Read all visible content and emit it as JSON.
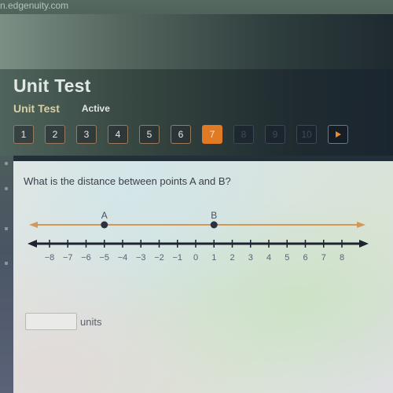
{
  "browser": {
    "url_fragment": "n.edgenuity.com"
  },
  "header": {
    "title": "Unit Test",
    "subtitle": "Unit Test",
    "status": "Active"
  },
  "question_nav": {
    "buttons": [
      {
        "label": "1",
        "state": "answered"
      },
      {
        "label": "2",
        "state": "answered"
      },
      {
        "label": "3",
        "state": "answered"
      },
      {
        "label": "4",
        "state": "answered"
      },
      {
        "label": "5",
        "state": "answered"
      },
      {
        "label": "6",
        "state": "answered"
      },
      {
        "label": "7",
        "state": "current"
      },
      {
        "label": "8",
        "state": "disabled"
      },
      {
        "label": "9",
        "state": "disabled"
      },
      {
        "label": "10",
        "state": "disabled"
      }
    ],
    "next_icon": "play-arrow-icon",
    "accent_color": "#e07a24"
  },
  "question": {
    "text": "What is the distance between points A and B?"
  },
  "number_line": {
    "min": -8,
    "max": 8,
    "tick_labels": [
      "−8",
      "−7",
      "−6",
      "−5",
      "−4",
      "−3",
      "−2",
      "−1",
      "0",
      "1",
      "2",
      "3",
      "4",
      "5",
      "6",
      "7",
      "8"
    ],
    "points": [
      {
        "label": "A",
        "value": -5
      },
      {
        "label": "B",
        "value": 1
      }
    ],
    "ray_color": "#d0995a",
    "axis_color": "#1e2230"
  },
  "answer": {
    "value": "",
    "placeholder": "",
    "units_label": "units"
  }
}
